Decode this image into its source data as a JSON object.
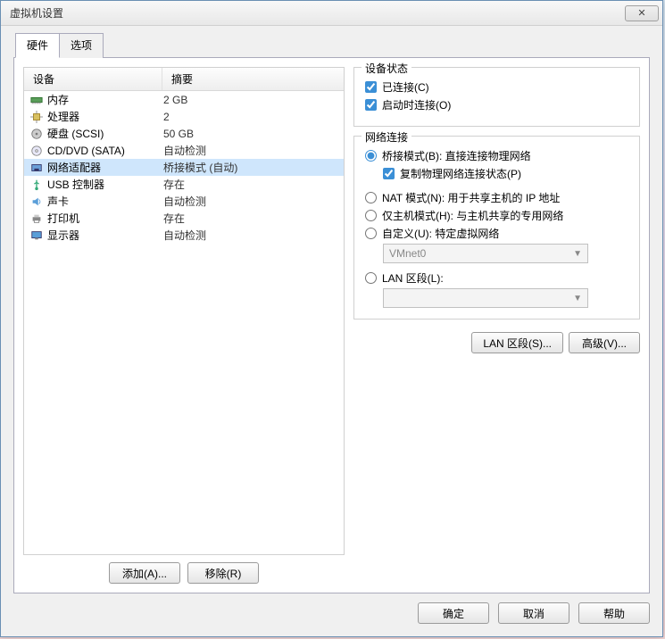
{
  "window": {
    "title": "虚拟机设置"
  },
  "tabs": {
    "hardware": "硬件",
    "options": "选项"
  },
  "list": {
    "col_device": "设备",
    "col_summary": "摘要"
  },
  "devices": [
    {
      "icon": "memory-icon",
      "name": "内存",
      "summary": "2 GB"
    },
    {
      "icon": "cpu-icon",
      "name": "处理器",
      "summary": "2"
    },
    {
      "icon": "disk-icon",
      "name": "硬盘 (SCSI)",
      "summary": "50 GB"
    },
    {
      "icon": "cd-icon",
      "name": "CD/DVD (SATA)",
      "summary": "自动检测"
    },
    {
      "icon": "nic-icon",
      "name": "网络适配器",
      "summary": "桥接模式 (自动)",
      "selected": true
    },
    {
      "icon": "usb-icon",
      "name": "USB 控制器",
      "summary": "存在"
    },
    {
      "icon": "sound-icon",
      "name": "声卡",
      "summary": "自动检测"
    },
    {
      "icon": "printer-icon",
      "name": "打印机",
      "summary": "存在"
    },
    {
      "icon": "display-icon",
      "name": "显示器",
      "summary": "自动检测"
    }
  ],
  "buttons": {
    "add": "添加(A)...",
    "remove": "移除(R)",
    "ok": "确定",
    "cancel": "取消",
    "help": "帮助",
    "lan_segments": "LAN 区段(S)...",
    "advanced": "高级(V)..."
  },
  "status_group": {
    "title": "设备状态",
    "connected": "已连接(C)",
    "connect_at_power": "启动时连接(O)"
  },
  "net_group": {
    "title": "网络连接",
    "bridged": "桥接模式(B): 直接连接物理网络",
    "replicate": "复制物理网络连接状态(P)",
    "nat": "NAT 模式(N): 用于共享主机的 IP 地址",
    "hostonly": "仅主机模式(H): 与主机共享的专用网络",
    "custom": "自定义(U): 特定虚拟网络",
    "custom_value": "VMnet0",
    "lan": "LAN 区段(L):",
    "lan_value": ""
  }
}
